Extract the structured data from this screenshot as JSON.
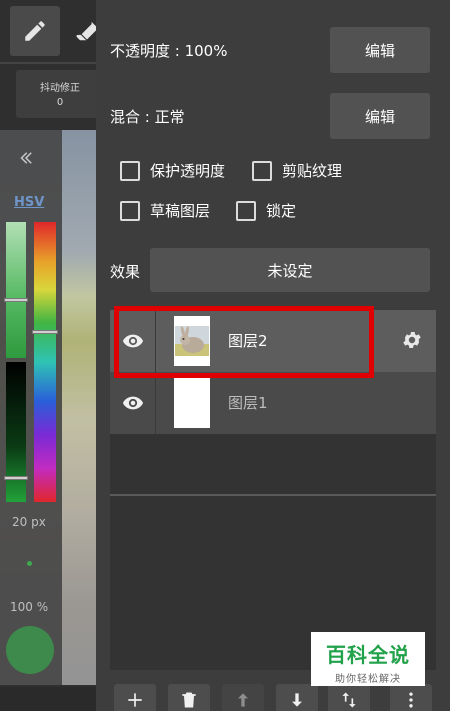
{
  "toolbar": {
    "stabilizer_label": "抖动修正",
    "stabilizer_value": "0"
  },
  "color_panel": {
    "mode_label": "HSV",
    "brush_size": "20 px",
    "brush_opacity": "100 %",
    "current_color": "#3e8a4c"
  },
  "layer_props": {
    "opacity_label": "不透明度 : 100%",
    "blend_label": "混合 : 正常",
    "edit_label": "编辑",
    "protect_alpha": "保护透明度",
    "clipping": "剪贴纹理",
    "draft_layer": "草稿图层",
    "lock": "锁定",
    "effect_label": "效果",
    "effect_value": "未设定"
  },
  "layers": [
    {
      "name": "图层2",
      "selected": true
    },
    {
      "name": "图层1",
      "selected": false
    }
  ],
  "watermark": {
    "title": "百科全说",
    "subtitle": "助你轻松解决"
  },
  "colors": {
    "highlight": "#e00000",
    "panel_bg": "#3d3d3d",
    "button_bg": "#525252",
    "watermark_green": "#21a24a"
  },
  "icons": [
    "pencil-icon",
    "eraser-icon",
    "chevron-left-icon",
    "eye-icon",
    "gear-icon",
    "plus-icon",
    "trash-icon",
    "arrow-up-icon",
    "arrow-down-icon",
    "swap-vertical-icon",
    "more-vertical-icon"
  ]
}
